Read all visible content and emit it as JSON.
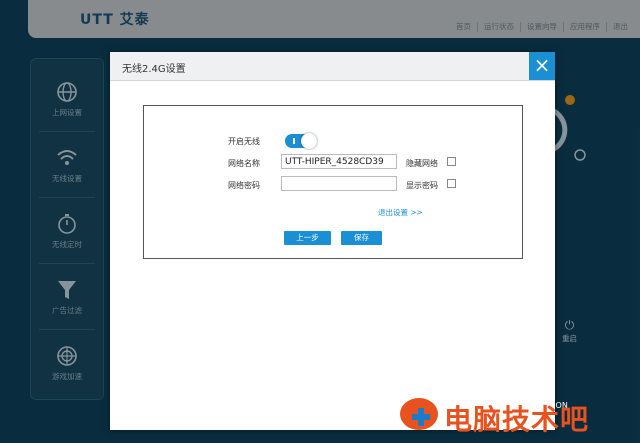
{
  "header": {
    "logo": "UTT 艾泰",
    "nav": [
      "首页",
      "运行状态",
      "设置向导",
      "应用程序",
      "退出"
    ]
  },
  "sidebar": {
    "items": [
      {
        "label": "上网设置",
        "icon": "globe-icon"
      },
      {
        "label": "无线设置",
        "icon": "wifi-icon"
      },
      {
        "label": "无线定时",
        "icon": "timer-icon"
      },
      {
        "label": "广告过滤",
        "icon": "filter-icon"
      },
      {
        "label": "游戏加速",
        "icon": "radar-icon"
      }
    ]
  },
  "right": {
    "restart_label": "重启",
    "close_label": "关 ON"
  },
  "modal": {
    "title": "无线2.4G设置",
    "close_glyph": "×",
    "wireless_label": "开启无线",
    "wireless_on": true,
    "ssid_label": "网络名称",
    "ssid_value": "UTT-HIPER_4528CD39",
    "hide_label": "隐藏网络",
    "password_label": "网络密码",
    "password_value": "",
    "show_password_label": "显示密码",
    "exit_link": "退出设置 >>",
    "prev_button": "上一步",
    "save_button": "保存"
  },
  "watermark": {
    "text": "电脑技术吧"
  },
  "colors": {
    "accent": "#1a8fd4",
    "background": "#0e4661",
    "watermark": "#e8521f"
  }
}
